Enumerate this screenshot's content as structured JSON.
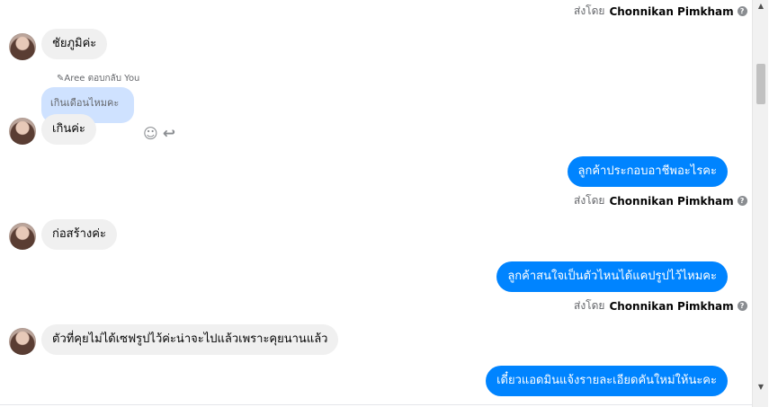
{
  "sender_name": "Chonnikan Pimkham",
  "sent_by_label": "ส่งโดย",
  "help_glyph": "?",
  "incoming": [
    {
      "text": "ชัยภูมิค่ะ"
    },
    {
      "text": "เกินค่ะ"
    },
    {
      "text": "ก่อสร้างค่ะ"
    },
    {
      "text": "ตัวที่คุยไม่ได้เซฟรูปไว้ค่ะน่าจะไปแล้วเพราะคุยนานแล้ว"
    }
  ],
  "reply_context": {
    "note": "Aree ตอบกลับ You",
    "quoted_text": "เกินเดือนไหมคะ"
  },
  "outgoing": [
    {
      "text": "ลูกค้าประกอบอาชีพอะไรคะ"
    },
    {
      "text": "ลูกค้าสนใจเป็นตัวไหนได้แคปรูปไว้ไหมคะ"
    },
    {
      "text": "เดี๋ยวแอดมินแจ้งรายละเอียดคันใหม่ให้นะคะ"
    }
  ],
  "icons": {
    "react": "☺",
    "reply": "↩",
    "reply_pencil": "✎",
    "scroll_up": "▲",
    "scroll_down": "▼"
  },
  "colors": {
    "outgoing_bubble": "#0084ff",
    "incoming_bubble": "#f0f0f0",
    "quoted_bubble": "#cfe2ff"
  }
}
